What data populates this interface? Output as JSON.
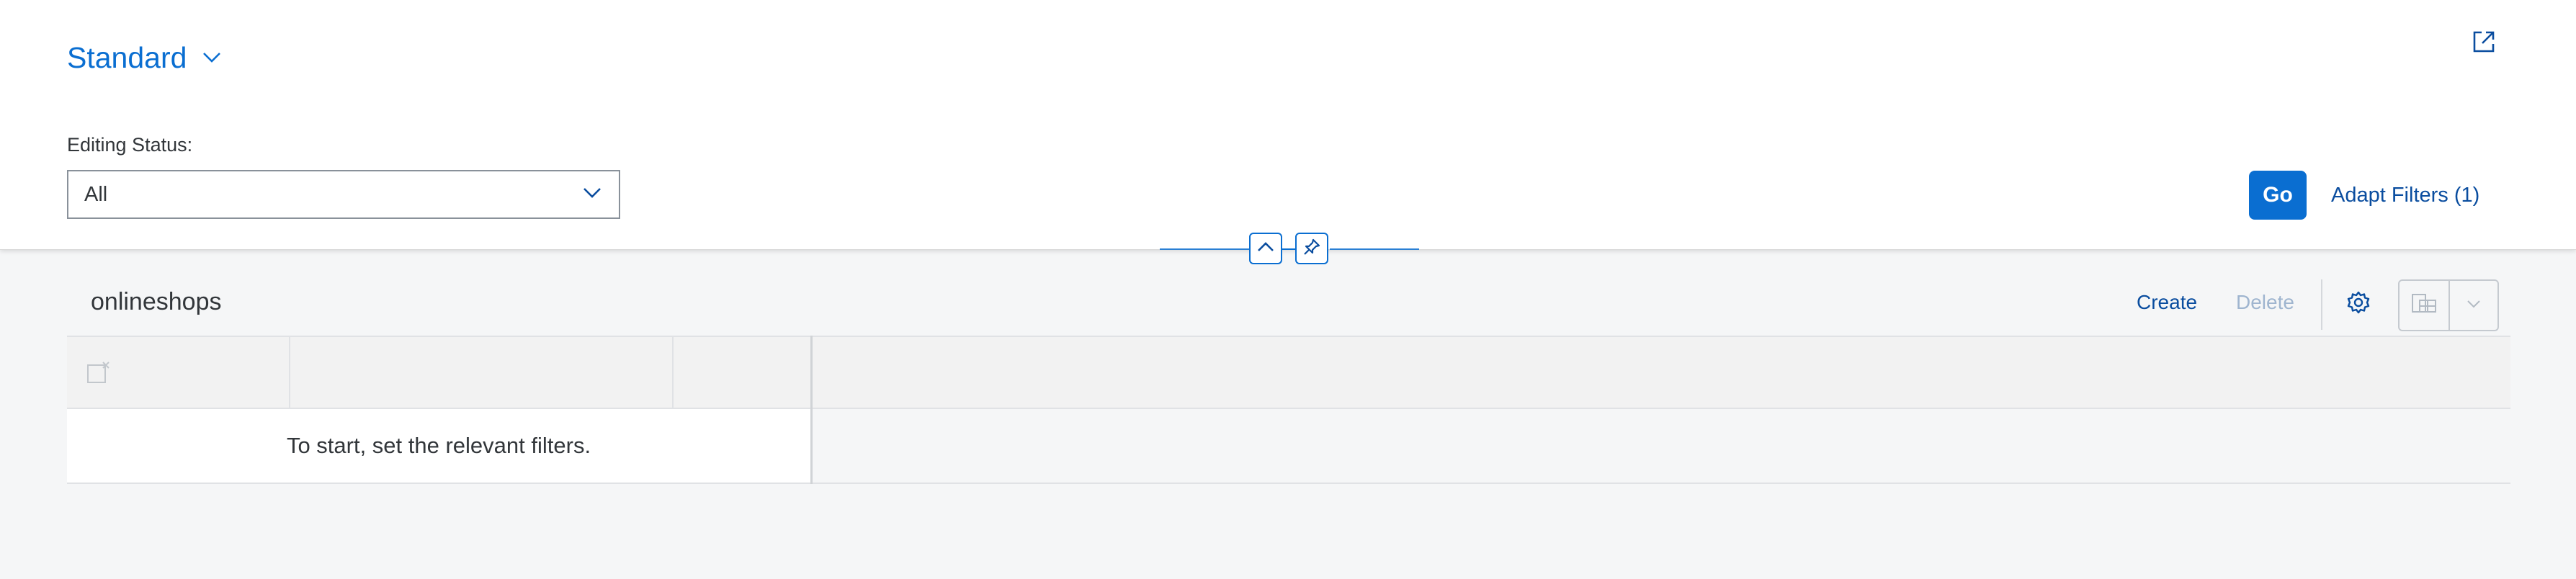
{
  "header": {
    "variant_title": "Standard",
    "filter_label": "Editing Status:",
    "filter_value": "All",
    "go_label": "Go",
    "adapt_filters_label": "Adapt Filters (1)"
  },
  "table": {
    "title": "onlineshops",
    "create_label": "Create",
    "delete_label": "Delete",
    "no_data_text": "To start, set the relevant filters."
  },
  "icons": {
    "variant_dropdown": "chevron-down-icon",
    "share": "share-icon",
    "select_dropdown": "chevron-down-icon",
    "collapse_header": "chevron-up-icon",
    "pin_header": "pin-icon",
    "select_all": "clear-selection-icon",
    "settings": "gear-icon",
    "export": "export-spreadsheet-icon",
    "export_menu": "chevron-down-icon"
  },
  "colors": {
    "brand": "#0a6ed1",
    "link": "#0a4d9f",
    "disabled": "#9fb5cf",
    "background": "#f5f6f7"
  }
}
